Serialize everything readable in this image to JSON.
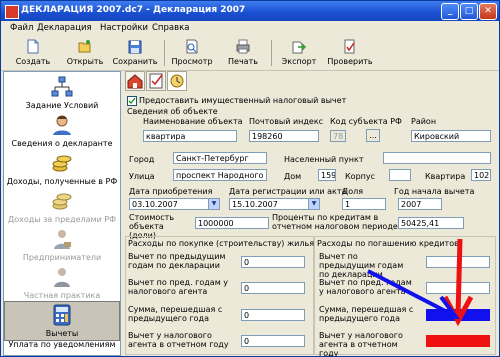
{
  "window": {
    "title": "ДЕКЛАРАЦИЯ 2007.dc7 - Декларация 2007",
    "minimize": "_",
    "maximize": "□",
    "close": "✕"
  },
  "menu": [
    "Файл",
    "Декларация",
    "Настройки",
    "Справка"
  ],
  "toolbar": [
    {
      "label": "Создать",
      "icon": "new-document-icon"
    },
    {
      "label": "Открыть",
      "icon": "open-folder-icon"
    },
    {
      "label": "Сохранить",
      "icon": "save-disk-icon"
    },
    {
      "label": "Просмотр",
      "icon": "preview-icon"
    },
    {
      "label": "Печать",
      "icon": "printer-icon"
    },
    {
      "label": "Экспорт",
      "icon": "export-icon"
    },
    {
      "label": "Проверить",
      "icon": "check-icon"
    }
  ],
  "sidebar": [
    {
      "label": "Задание Условий",
      "icon": "network-icon",
      "enabled": true
    },
    {
      "label": "Сведения о декларанте",
      "icon": "person-icon",
      "enabled": true
    },
    {
      "label": "Доходы, полученные в РФ",
      "icon": "coins-icon",
      "enabled": true
    },
    {
      "label": "Доходы за пределами РФ",
      "icon": "coins-icon",
      "enabled": false
    },
    {
      "label": "Предприниматели",
      "icon": "businessman-icon",
      "enabled": false
    },
    {
      "label": "Частная практика",
      "icon": "lawyer-icon",
      "enabled": false
    },
    {
      "label": "Вычеты",
      "icon": "calculator-icon",
      "enabled": true,
      "selected": true
    },
    {
      "label": "Уплата по уведомлениям",
      "icon": "",
      "enabled": true
    }
  ],
  "form": {
    "checkbox_label": "Предоставить имущественный налоговый вычет",
    "checkbox_checked": true,
    "section_title": "Сведения об объекте",
    "labels": {
      "name": "Наименование объекта",
      "postcode": "Почтовый индекс",
      "region_code": "Код субъекта РФ",
      "district": "Район",
      "city": "Город",
      "settlement": "Населенный пункт",
      "street": "Улица",
      "house": "Дом",
      "building": "Корпус",
      "apartment": "Квартира",
      "acquisition_date": "Дата приобретения",
      "registration_date": "Дата регистрации или акта",
      "share": "Доля",
      "start_year": "Год начала вычета",
      "cost": "Стоимость объекта (доли)",
      "interest": "Проценты по кредитам в отчетном налоговом периоде"
    },
    "values": {
      "name": "квартира",
      "postcode": "198260",
      "region_code": "78",
      "region_btn": "...",
      "district": "Кировский",
      "city": "Санкт-Петербург",
      "settlement": "",
      "street": "проспект Народного",
      "house": "159",
      "building": "",
      "apartment": "102",
      "acquisition_date": "03.10.2007",
      "registration_date": "15.10.2007",
      "share": "1",
      "start_year": "2007",
      "cost": "1000000",
      "interest": "50425,41"
    }
  },
  "purchase": {
    "title": "Расходы по покупке (строительству) жилья",
    "rows": [
      {
        "label": "Вычет по предыдущим годам по декларации",
        "value": "0"
      },
      {
        "label": "Вычет по пред. годам у налогового агента",
        "value": "0"
      },
      {
        "label": "Сумма, перешедшая с предыдущего года",
        "value": "0"
      },
      {
        "label": "Вычет у налогового агента в отчетном году",
        "value": "0"
      }
    ]
  },
  "credit": {
    "title": "Расходы по погашению кредитов",
    "rows": [
      {
        "label": "Вычет по предыдущим годам по декларации",
        "value": ""
      },
      {
        "label": "Вычет по пред. годам у налогового агента",
        "value": ""
      },
      {
        "label": "Сумма, перешедшая с предыдущего года",
        "value": ""
      },
      {
        "label": "Вычет у налогового агента в отчетном году",
        "value": ""
      }
    ]
  },
  "colors": {
    "annotation_red": "#ee1111",
    "annotation_blue": "#1111ee",
    "titlebar": "#1a4fd1"
  }
}
